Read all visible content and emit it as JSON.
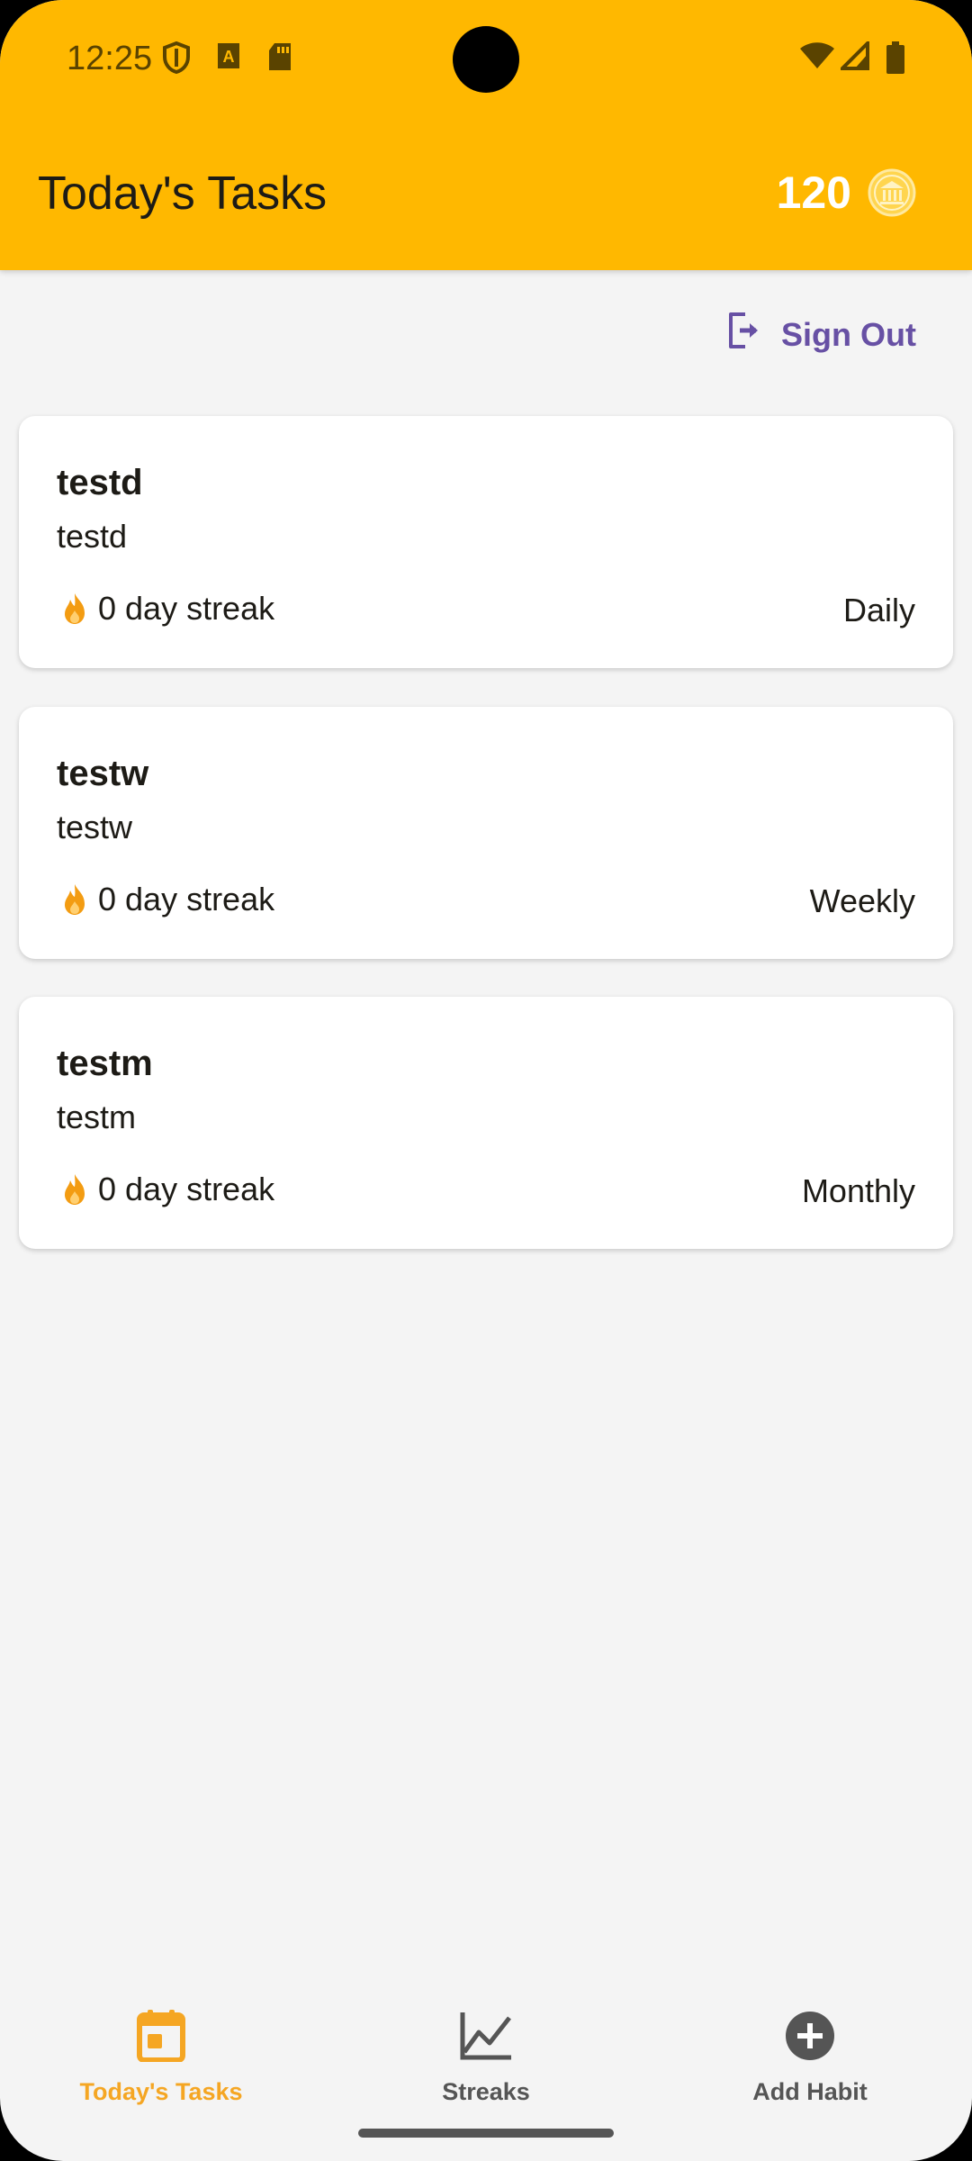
{
  "status_bar": {
    "time": "12:25"
  },
  "header": {
    "title": "Today's Tasks",
    "coins": "120"
  },
  "actions": {
    "sign_out_label": "Sign Out"
  },
  "tasks": [
    {
      "title": "testd",
      "description": "testd",
      "streak": "0 day streak",
      "frequency": "Daily"
    },
    {
      "title": "testw",
      "description": "testw",
      "streak": "0 day streak",
      "frequency": "Weekly"
    },
    {
      "title": "testm",
      "description": "testm",
      "streak": "0 day streak",
      "frequency": "Monthly"
    }
  ],
  "bottom_nav": {
    "items": [
      {
        "label": "Today's Tasks",
        "icon": "calendar-icon",
        "active": true
      },
      {
        "label": "Streaks",
        "icon": "chart-line-icon",
        "active": false
      },
      {
        "label": "Add Habit",
        "icon": "add-circle-icon",
        "active": false
      }
    ]
  },
  "colors": {
    "header": "#ffb800",
    "accent_active_nav": "#f5a623",
    "sign_out": "#6750a4",
    "flame": "#f39c12"
  }
}
